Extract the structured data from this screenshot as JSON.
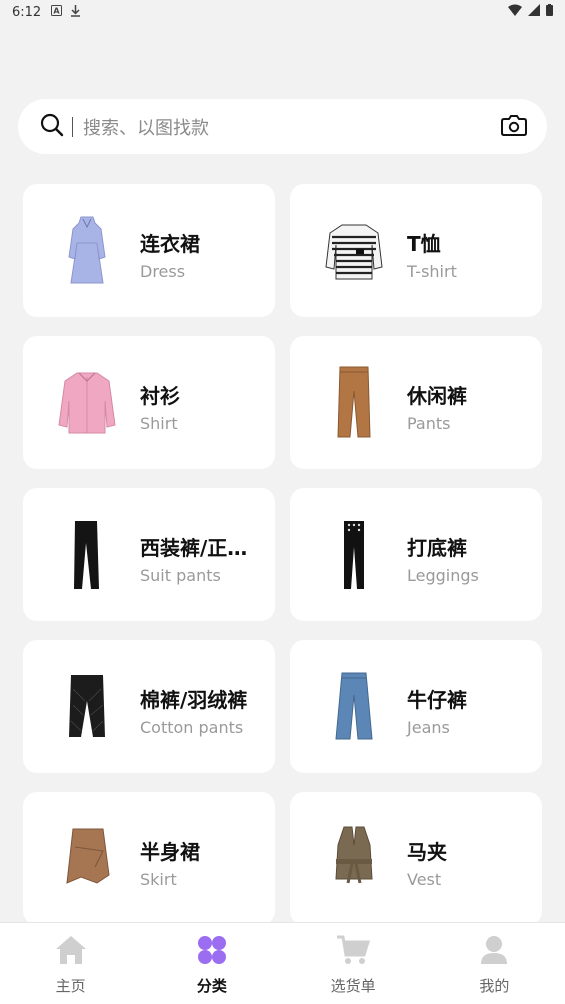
{
  "status": {
    "time": "6:12"
  },
  "search": {
    "placeholder": "搜索、以图找款"
  },
  "categories": [
    {
      "zh": "连衣裙",
      "en": "Dress"
    },
    {
      "zh": "T恤",
      "en": "T-shirt"
    },
    {
      "zh": "衬衫",
      "en": "Shirt"
    },
    {
      "zh": "休闲裤",
      "en": "Pants"
    },
    {
      "zh": "西装裤/正…",
      "en": "Suit pants"
    },
    {
      "zh": "打底裤",
      "en": "Leggings"
    },
    {
      "zh": "棉裤/羽绒裤",
      "en": "Cotton pants"
    },
    {
      "zh": "牛仔裤",
      "en": "Jeans"
    },
    {
      "zh": "半身裙",
      "en": "Skirt"
    },
    {
      "zh": "马夹",
      "en": "Vest"
    }
  ],
  "nav": [
    {
      "label": "主页",
      "icon": "home-icon"
    },
    {
      "label": "分类",
      "icon": "category-icon",
      "active": true
    },
    {
      "label": "选货单",
      "icon": "cart-icon"
    },
    {
      "label": "我的",
      "icon": "profile-icon"
    }
  ],
  "colors": {
    "accent": "#9b6df0",
    "inactive_icon": "#cfcfcf",
    "background": "#f2f2f2"
  }
}
